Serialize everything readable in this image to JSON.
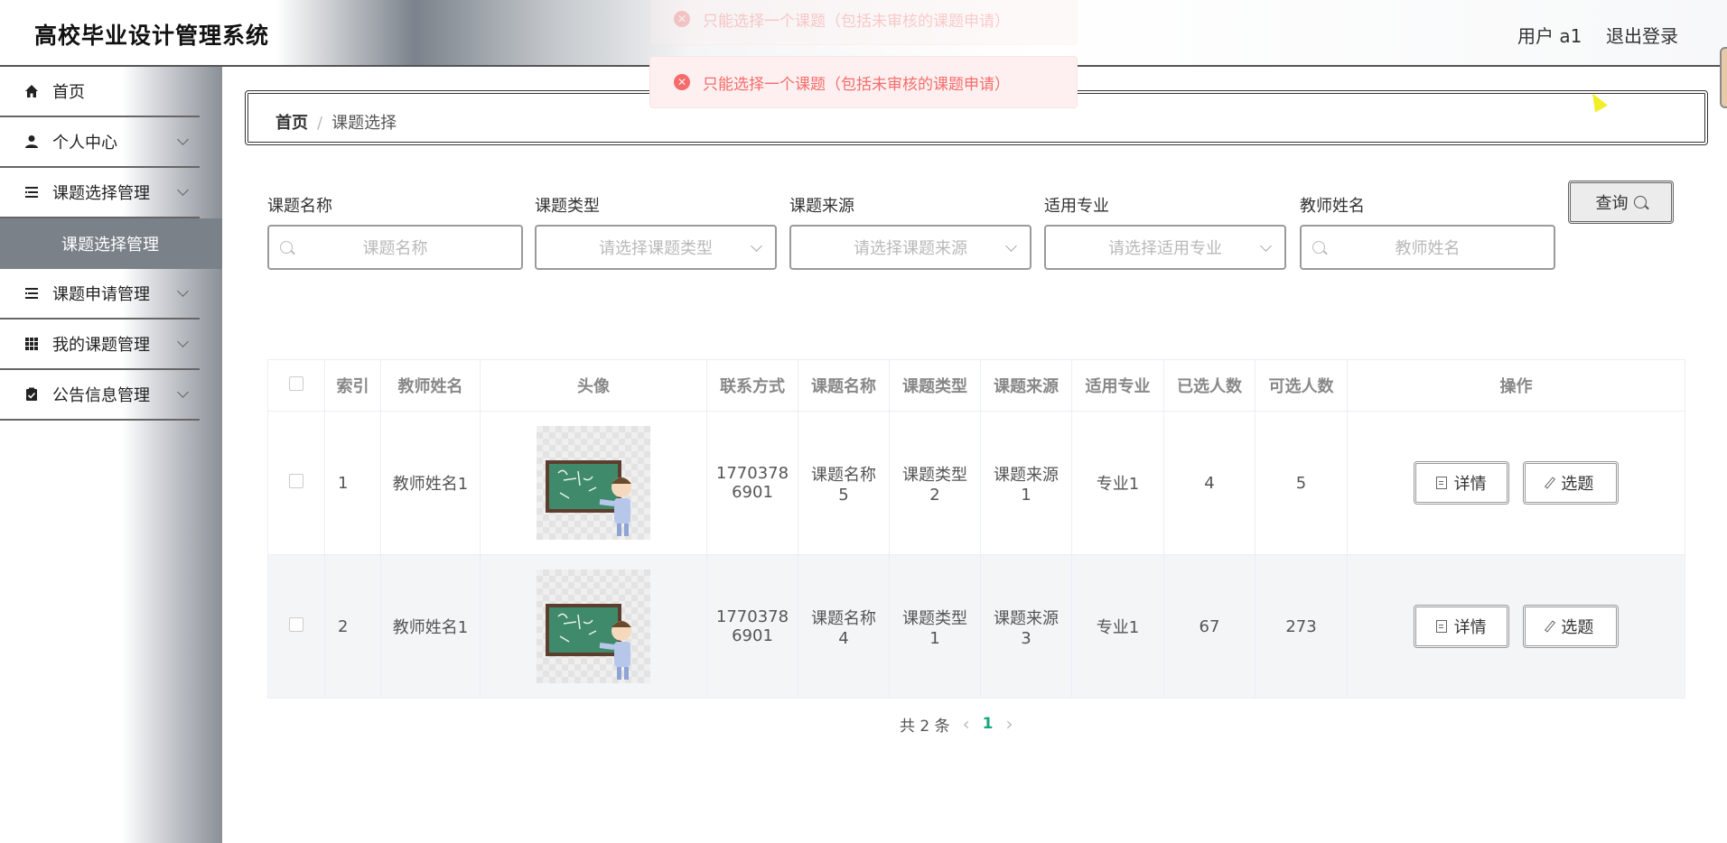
{
  "app": {
    "title": "高校毕业设计管理系统",
    "user_label": "用户 a1",
    "logout_label": "退出登录"
  },
  "sidebar": {
    "items": [
      {
        "label": "首页",
        "icon": "home-icon"
      },
      {
        "label": "个人中心",
        "icon": "user-icon"
      },
      {
        "label": "课题选择管理",
        "icon": "list-icon"
      },
      {
        "label": "课题申请管理",
        "icon": "list-icon"
      },
      {
        "label": "我的课题管理",
        "icon": "grid-icon"
      },
      {
        "label": "公告信息管理",
        "icon": "clipboard-check-icon"
      }
    ],
    "active_sub": "课题选择管理"
  },
  "breadcrumb": {
    "home": "首页",
    "sep": "/",
    "current": "课题选择"
  },
  "toasts": {
    "message": "只能选择一个课题（包括未审核的课题申请）"
  },
  "search": {
    "fields": [
      {
        "label": "课题名称",
        "placeholder": "课题名称"
      },
      {
        "label": "课题类型",
        "placeholder": "请选择课题类型"
      },
      {
        "label": "课题来源",
        "placeholder": "请选择课题来源"
      },
      {
        "label": "适用专业",
        "placeholder": "请选择适用专业"
      },
      {
        "label": "教师姓名",
        "placeholder": "教师姓名"
      }
    ],
    "query_label": "查询"
  },
  "table": {
    "headers": [
      "索引",
      "教师姓名",
      "头像",
      "联系方式",
      "课题名称",
      "课题类型",
      "课题来源",
      "适用专业",
      "已选人数",
      "可选人数",
      "操作"
    ],
    "rows": [
      {
        "index": "1",
        "teacher": "教师姓名1",
        "phone_a": "1770378",
        "phone_b": "6901",
        "name_a": "课题名称",
        "name_b": "5",
        "type_a": "课题类型",
        "type_b": "2",
        "source_a": "课题来源",
        "source_b": "1",
        "major": "专业1",
        "selected": "4",
        "available": "5"
      },
      {
        "index": "2",
        "teacher": "教师姓名1",
        "phone_a": "1770378",
        "phone_b": "6901",
        "name_a": "课题名称",
        "name_b": "4",
        "type_a": "课题类型",
        "type_b": "1",
        "source_a": "课题来源",
        "source_b": "3",
        "major": "专业1",
        "selected": "67",
        "available": "273"
      }
    ],
    "detail_label": "详情",
    "select_label": "选题"
  },
  "pagination": {
    "total_text": "共 2 条",
    "current_page": "1"
  },
  "colors": {
    "accent": "#1aa67c",
    "error": "#f56c6c",
    "active_menu": "#7b8189"
  }
}
